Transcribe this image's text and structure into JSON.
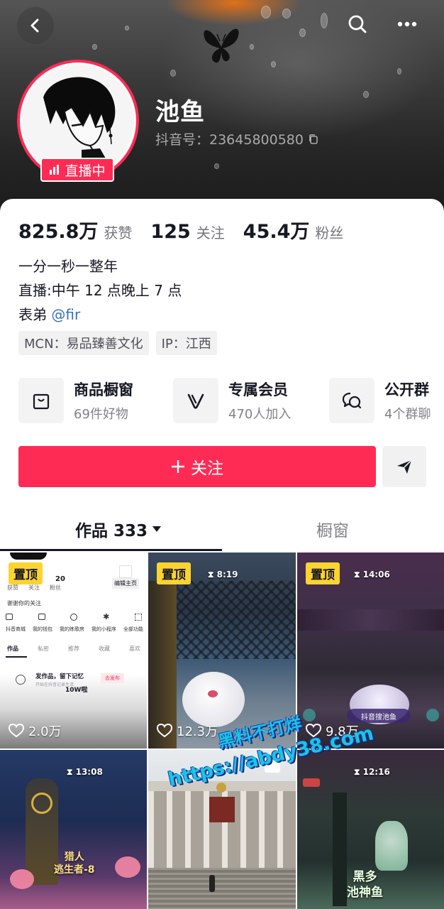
{
  "header": {
    "nickname": "池鱼",
    "douyin_id": "抖音号：23645800580",
    "live_label": "直播中"
  },
  "stats": [
    {
      "value": "825.8万",
      "label": "获赞"
    },
    {
      "value": "125",
      "label": "关注"
    },
    {
      "value": "45.4万",
      "label": "粉丝"
    }
  ],
  "bio": {
    "line1": "一分一秒一整年",
    "line2": "直播:中午 12 点晚上 7 点",
    "line3_prefix": "表弟 ",
    "line3_mention": "@fir"
  },
  "tags": [
    "MCN：易品臻善文化",
    "IP：江西"
  ],
  "services": [
    {
      "title": "商品橱窗",
      "sub": "69件好物",
      "icon": "shopping-bag-icon"
    },
    {
      "title": "专属会员",
      "sub": "470人加入",
      "icon": "v-member-icon"
    },
    {
      "title": "公开群",
      "sub": "4个群聊",
      "icon": "chat-bubble-icon"
    }
  ],
  "actions": {
    "follow_label": "关注",
    "share_icon": "paper-plane-icon"
  },
  "tabs": {
    "works_label": "作品 333",
    "window_label": "橱窗"
  },
  "videos": [
    {
      "pinned": "置顶",
      "likes": "2.0万",
      "thumb": "app-screenshot"
    },
    {
      "pinned": "置顶",
      "likes": "12.3万",
      "timer": "8:19",
      "thumb": "game-night"
    },
    {
      "pinned": "置顶",
      "likes": "9.8万",
      "timer": "14:06",
      "caption": "抖音搜池鱼",
      "thumb": "game-purple"
    },
    {
      "timer": "13:08",
      "caption": "猎人\n逃生者-8",
      "thumb": "game-clock"
    },
    {
      "thumb": "building-photo"
    },
    {
      "timer": "12:16",
      "caption": "黑多\n池神鱼",
      "thumb": "game-forest"
    }
  ],
  "thumb_texts": {
    "app_stat_num": "20",
    "app_stat_a": "获赞",
    "app_stat_b": "关注",
    "app_stat_c": "粉丝",
    "app_edit": "编辑主页",
    "app_thanks": "谢谢你的关注",
    "app_menu": [
      "抖音商城",
      "我的钱包",
      "我的练歌房",
      "我的小程序",
      "全部功能"
    ],
    "app_tabs": [
      "作品",
      "私密",
      "推荐",
      "收藏",
      "喜欢"
    ],
    "app_publish": "发作品，留下记忆",
    "app_publish_sub": "开始在抖音记录生活",
    "app_publish_btn": "去发布",
    "app_10w": "10W啦"
  },
  "watermark": {
    "line1": "黑料不打烊",
    "line2": "https://abdy38.com"
  },
  "colors": {
    "brand": "#fe2c55",
    "pin": "#fdd32f",
    "mention": "#3c6fb8",
    "watermark": "#19c6e0"
  }
}
